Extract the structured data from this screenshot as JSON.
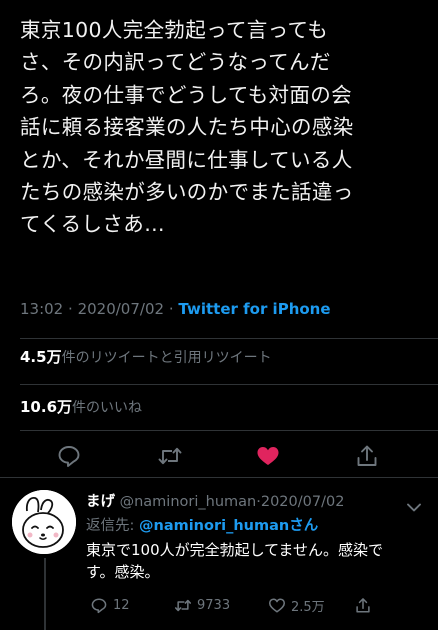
{
  "tweet": {
    "text": "東京100人完全勃起って言っても\nさ、その内訳ってどうなってんだ\nろ。夜の仕事でどうしても対面の会\n話に頼る接客業の人たち中心の感染\nとか、それか昼間に仕事している人\nたちの感染が多いのかでまた話違っ\nてくるしさあ…",
    "time": "13:02",
    "date": "2020/07/02",
    "separator": "·",
    "source": "Twitter for iPhone",
    "retweet_count": "4.5万",
    "retweet_label": "件のリツイートと引用リツイート",
    "like_count": "10.6万",
    "like_label": "件のいいね"
  },
  "actions": [
    {
      "name": "reply",
      "icon": "reply-icon"
    },
    {
      "name": "retweet",
      "icon": "retweet-icon"
    },
    {
      "name": "like",
      "icon": "heart-icon",
      "active": true,
      "color": "#e0245e"
    },
    {
      "name": "share",
      "icon": "share-icon"
    }
  ],
  "reply": {
    "display_name": "まげ",
    "handle": "@naminori_human",
    "separator": "·",
    "date": "2020/07/02",
    "replying_to_label": "返信先: ",
    "replying_to_handle": "@naminori_humanさん",
    "text": "東京で100人が完全勃起してません。感染で\nす。感染。",
    "reply_count": "12",
    "retweet_count": "9733",
    "like_count": "2.5万",
    "avatar_icon": "cartoon-rabbit-avatar"
  },
  "colors": {
    "background": "#000000",
    "text": "#ffffff",
    "secondary": "#6e767d",
    "link": "#1d9bf0",
    "like_active": "#e0245e",
    "divider": "#2f3336"
  }
}
